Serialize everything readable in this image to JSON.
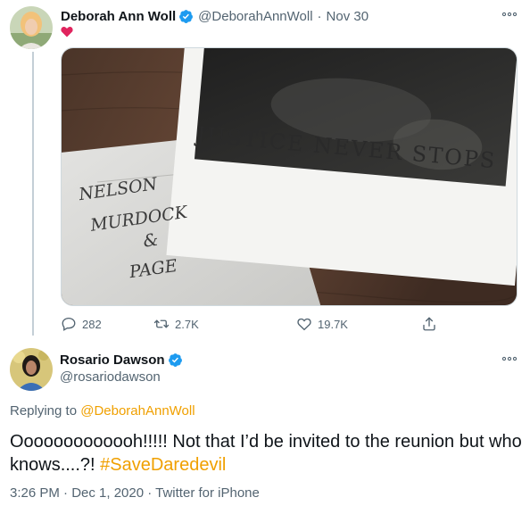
{
  "tweet1": {
    "display_name": "Deborah Ann Woll",
    "handle": "@DeborahAnnWoll",
    "separator": "·",
    "date": "Nov 30",
    "content_icon": "red-heart-icon",
    "image_texts": {
      "card": "JUSTICE NEVER STOPS",
      "napkin_line1": "NELSON",
      "napkin_line2": "MURDOCK",
      "napkin_line3": "&",
      "napkin_line4": "PAGE"
    },
    "stats": {
      "replies": "282",
      "retweets": "2.7K",
      "likes": "19.7K"
    }
  },
  "tweet2": {
    "display_name": "Rosario Dawson",
    "handle": "@rosariodawson",
    "replying_prefix": "Replying to",
    "replying_to": "@DeborahAnnWoll",
    "text_before": "Ooooooooooooh!!!!! Not that I’d be invited to the reunion but who knows....?! ",
    "hashtag": "#SaveDaredevil",
    "meta": "3:26 PM · Dec 1, 2020 · Twitter for iPhone"
  },
  "colors": {
    "accent_link": "#f0a000",
    "verified_blue": "#1d9bf0",
    "heart_red": "#e0245e",
    "secondary_text": "#536471"
  }
}
